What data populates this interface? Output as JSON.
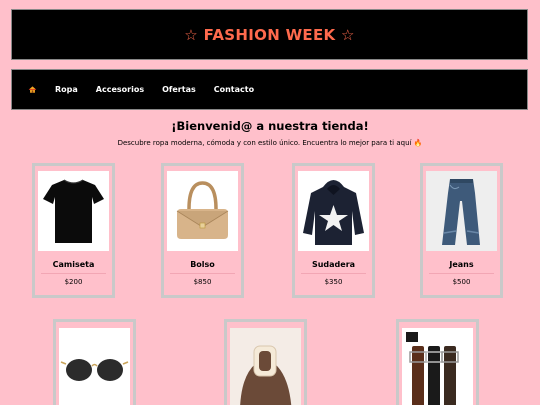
{
  "header": {
    "title": "☆ FASHION WEEK ☆"
  },
  "nav": {
    "home_icon": "home-icon",
    "items": [
      "Ropa",
      "Accesorios",
      "Ofertas",
      "Contacto"
    ]
  },
  "intro": {
    "heading": "¡Bienvenid@ a nuestra tienda!",
    "subtitle": "Descubre ropa moderna, cómoda y con estilo único. Encuentra lo mejor para ti aquí 🔥"
  },
  "products": [
    {
      "name": "Camiseta",
      "price": "$200"
    },
    {
      "name": "Bolso",
      "price": "$850"
    },
    {
      "name": "Sudadera",
      "price": "$350"
    },
    {
      "name": "Jeans",
      "price": "$500"
    }
  ],
  "products_row2": [
    {
      "image": "sunglasses"
    },
    {
      "image": "hair-clip"
    },
    {
      "image": "belts"
    }
  ],
  "colors": {
    "background": "#ffc0cb",
    "banner": "#000000",
    "title": "#ff6a4d"
  }
}
